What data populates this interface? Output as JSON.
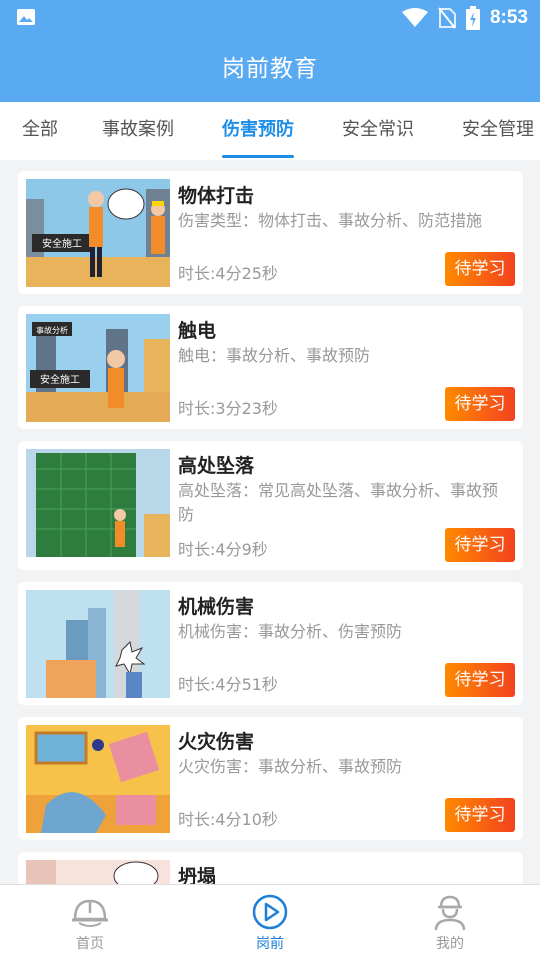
{
  "status_bar": {
    "time": "8:53"
  },
  "app_bar": {
    "title": "岗前教育"
  },
  "tabs": [
    {
      "label": "全部"
    },
    {
      "label": "事故案例"
    },
    {
      "label": "伤害预防",
      "active": true
    },
    {
      "label": "安全常识"
    },
    {
      "label": "安全管理"
    }
  ],
  "courses": [
    {
      "title": "物体打击",
      "desc": "伤害类型：物体打击、事故分析、防范措施",
      "duration": "时长:4分25秒",
      "status": "待学习",
      "thumb_text": "安全施工"
    },
    {
      "title": "触电",
      "desc": "触电：事故分析、事故预防",
      "duration": "时长:3分23秒",
      "status": "待学习",
      "thumb_text": "安全施工",
      "thumb_text2": "事故分析"
    },
    {
      "title": "高处坠落",
      "desc": "高处坠落：常见高处坠落、事故分析、事故预防",
      "duration": "时长:4分9秒",
      "status": "待学习"
    },
    {
      "title": "机械伤害",
      "desc": "机械伤害：事故分析、伤害预防",
      "duration": "时长:4分51秒",
      "status": "待学习"
    },
    {
      "title": "火灾伤害",
      "desc": "火灾伤害：事故分析、事故预防",
      "duration": "时长:4分10秒",
      "status": "待学习"
    },
    {
      "title": "坍塌",
      "desc": "",
      "duration": "",
      "status": ""
    }
  ],
  "bottom_nav": [
    {
      "label": "首页",
      "icon": "helmet-icon"
    },
    {
      "label": "岗前",
      "icon": "play-circle-icon",
      "active": true
    },
    {
      "label": "我的",
      "icon": "user-helmet-icon"
    }
  ],
  "colors": {
    "primary": "#5aaaf2",
    "tab_active": "#1e8ee6",
    "button_start": "#ff8a00",
    "button_end": "#f2421f"
  }
}
